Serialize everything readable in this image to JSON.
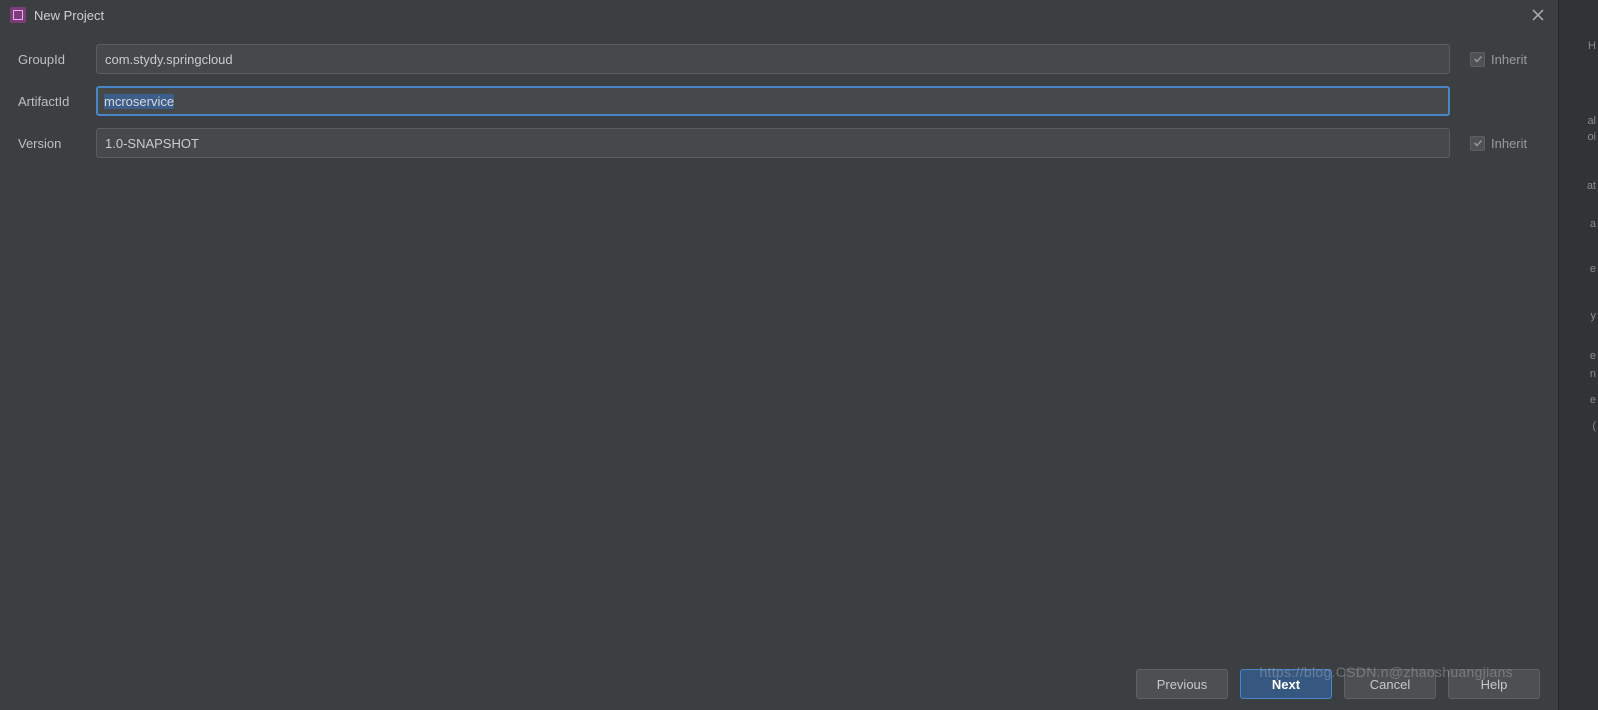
{
  "window": {
    "title": "New Project"
  },
  "form": {
    "group_id": {
      "label": "GroupId",
      "value": "com.stydy.springcloud",
      "inherit_label": "Inherit",
      "inherit_checked": true
    },
    "artifact_id": {
      "label": "ArtifactId",
      "value": "mcroservice"
    },
    "version": {
      "label": "Version",
      "value": "1.0-SNAPSHOT",
      "inherit_label": "Inherit",
      "inherit_checked": true
    }
  },
  "buttons": {
    "previous": "Previous",
    "next": "Next",
    "cancel": "Cancel",
    "help": "Help"
  },
  "watermark": "https://blog.CSDN.n@zhaoshuangjians",
  "side": {
    "f1": "H",
    "f2": "al",
    "f3": "oi",
    "f4": "at",
    "f5": "a",
    "f6": "e",
    "f7": "y",
    "f8": "e",
    "f9": "n",
    "f10": "e",
    "f11": "(",
    "f12": ""
  }
}
